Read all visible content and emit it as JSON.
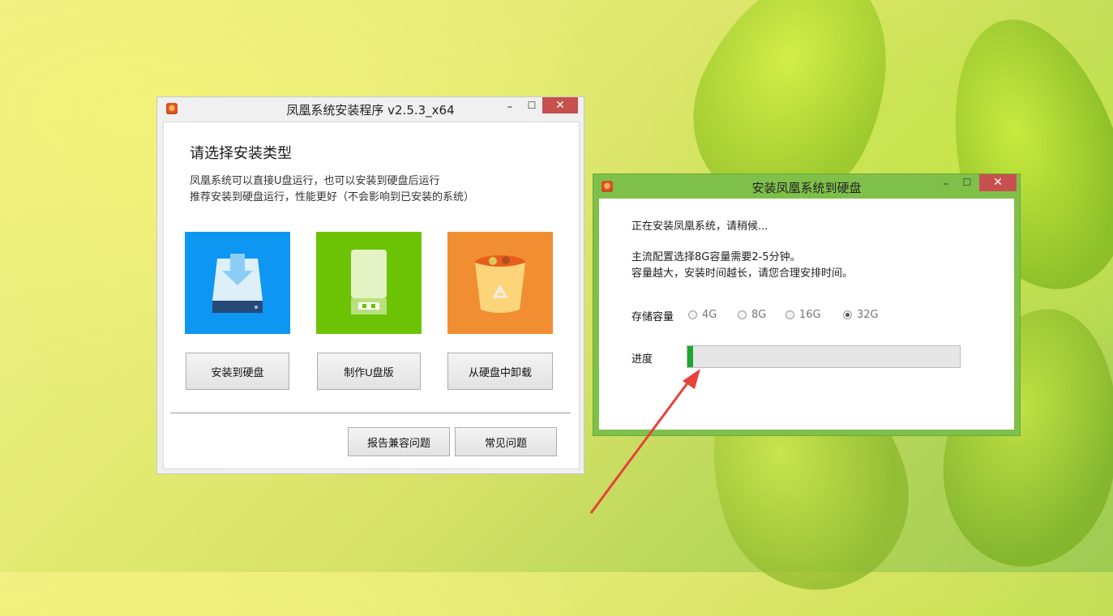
{
  "installer": {
    "title": "凤凰系统安装程序 v2.5.3_x64",
    "minimize": "–",
    "maximize": "☐",
    "close": "✕",
    "heading": "请选择安装类型",
    "desc_line1": "凤凰系统可以直接U盘运行，也可以安装到硬盘后运行",
    "desc_line2": "推荐安装到硬盘运行，性能更好（不会影响到已安装的系统）",
    "options": [
      {
        "label": "安装到硬盘",
        "icon": "hard-disk-download-icon",
        "color": "#0e96f3"
      },
      {
        "label": "制作U盘版",
        "icon": "usb-drive-icon",
        "color": "#6cc305"
      },
      {
        "label": "从硬盘中卸载",
        "icon": "recycle-bin-icon",
        "color": "#f28e32"
      }
    ],
    "report_button": "报告兼容问题",
    "faq_button": "常见问题"
  },
  "install_dialog": {
    "title": "安装凤凰系统到硬盘",
    "minimize": "–",
    "maximize": "☐",
    "close": "✕",
    "status": "正在安装凤凰系统，请稍候...",
    "note_line1": "主流配置选择8G容量需要2-5分钟。",
    "note_line2": "容量越大，安装时间越长，请您合理安排时间。",
    "capacity_label": "存储容量",
    "capacity_options": [
      "4G",
      "8G",
      "16G",
      "32G"
    ],
    "capacity_selected": "32G",
    "progress_label": "进度",
    "progress_fraction": 0.02
  },
  "colors": {
    "window_green": "#7fc04a",
    "close_red": "#c7504e",
    "progress_green": "#1aa832",
    "annotation_arrow": "#e8413a"
  }
}
